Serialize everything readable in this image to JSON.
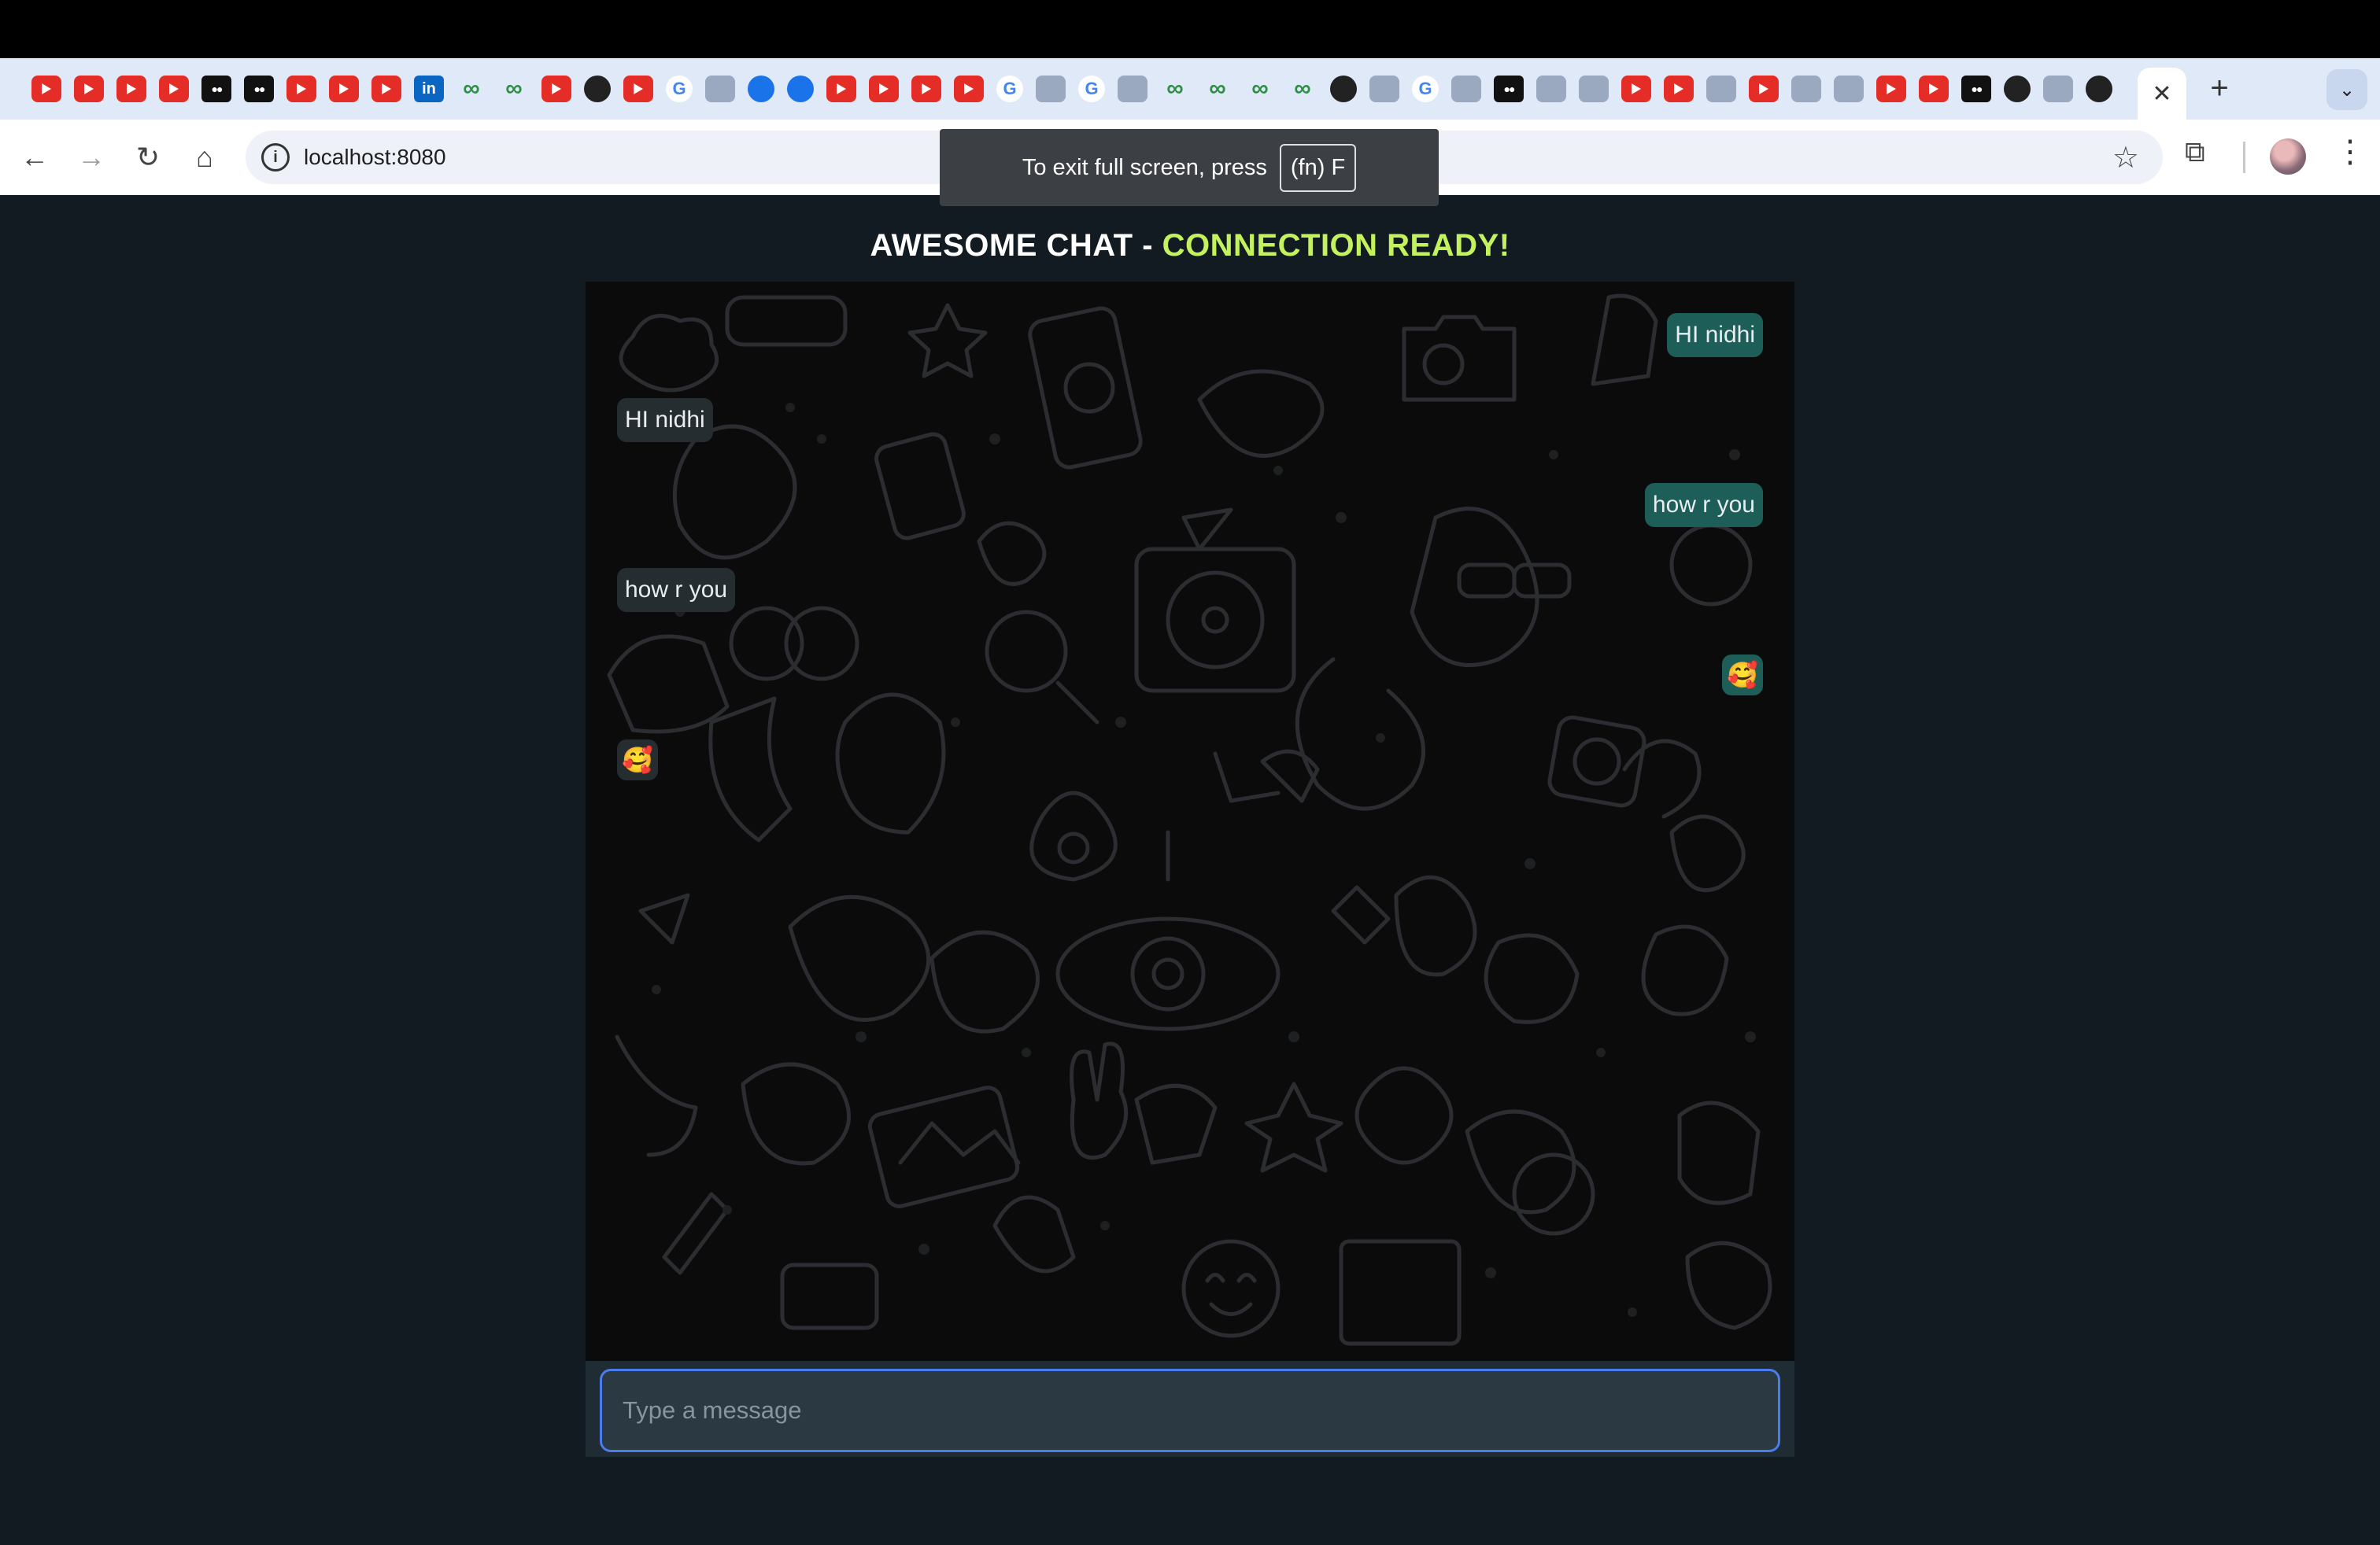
{
  "browser": {
    "tabs": {
      "favicons": [
        "youtube",
        "youtube",
        "youtube",
        "youtube",
        "medium",
        "medium",
        "youtube",
        "youtube",
        "youtube",
        "linkedin",
        "geeksforgeeks",
        "geeksforgeeks",
        "youtube",
        "github",
        "youtube",
        "google",
        "wikipedia",
        "blue-circle",
        "typescript",
        "youtube",
        "youtube",
        "youtube",
        "youtube",
        "google",
        "chromium",
        "google",
        "stackoverflow",
        "geeksforgeeks",
        "geeksforgeeks",
        "geeksforgeeks",
        "geeksforgeeks",
        "github",
        "edge",
        "google",
        "graphql",
        "medium",
        "generic",
        "generic",
        "youtube",
        "youtube",
        "opera",
        "youtube",
        "arrow",
        "vue",
        "youtube",
        "youtube",
        "medium",
        "github",
        "gear",
        "github"
      ],
      "active_tab_close": "✕",
      "new_tab": "+",
      "tab_search": "⌄"
    },
    "toolbar": {
      "back": "←",
      "forward": "→",
      "reload": "↻",
      "home": "⌂",
      "site_info": "i",
      "url": "localhost:8080",
      "bookmark": "☆",
      "extensions": "⧉",
      "menu": "⋮"
    },
    "fullscreen_notice": {
      "text": "To exit full screen, press",
      "key": "(fn) F"
    }
  },
  "app": {
    "title": "AWESOME CHAT - ",
    "status": "CONNECTION READY!",
    "messages": [
      {
        "side": "sent",
        "text": "HI nidhi"
      },
      {
        "side": "recv",
        "text": "HI nidhi"
      },
      {
        "side": "sent",
        "text": "how r you"
      },
      {
        "side": "recv",
        "text": "how r you"
      },
      {
        "side": "sent",
        "text": "🥰"
      },
      {
        "side": "recv",
        "text": "🥰"
      }
    ],
    "input_placeholder": "Type a message",
    "input_value": ""
  },
  "colors": {
    "page_bg": "#111b21",
    "status_green": "#c3f25e",
    "sent_bubble": "#1e5e58",
    "recv_bubble": "#262d31",
    "input_border": "#4b7bec"
  }
}
